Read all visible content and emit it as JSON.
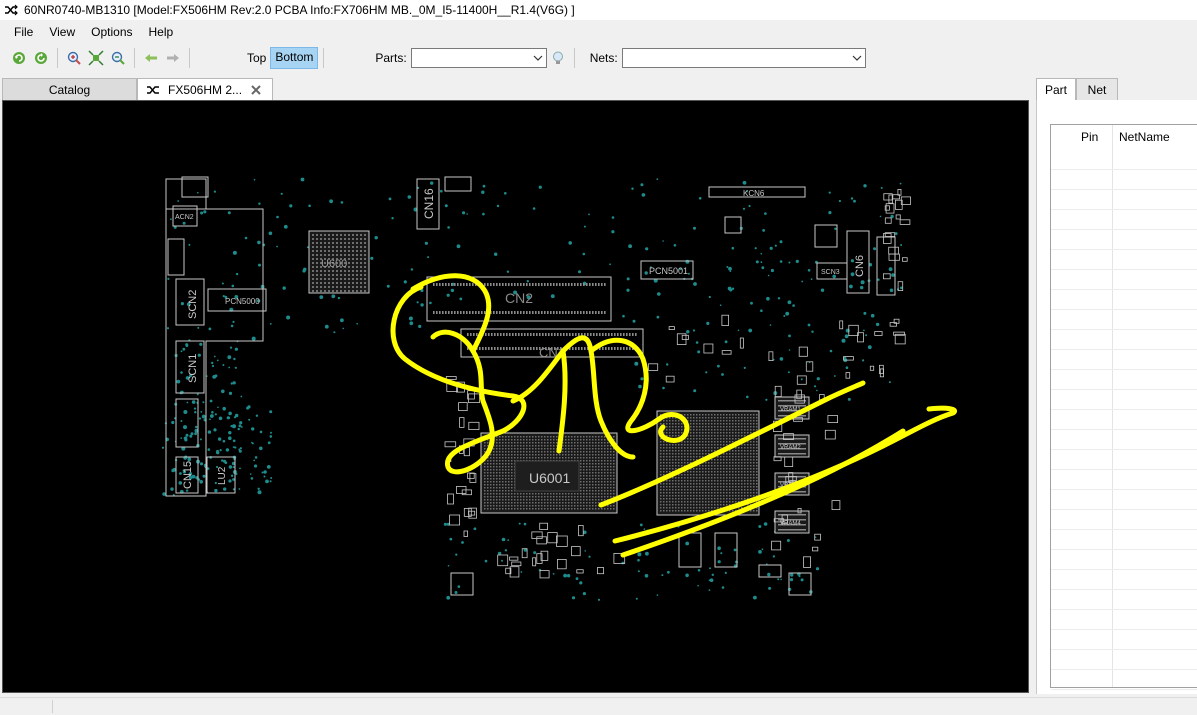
{
  "window": {
    "title": "60NR0740-MB1310 [Model:FX506HM  Rev:2.0 PCBA Info:FX706HM MB._0M_I5-11400H__R1.4(V6G) ]"
  },
  "menu": {
    "items": [
      "File",
      "View",
      "Options",
      "Help"
    ]
  },
  "toolbar": {
    "icons": [
      "refresh-icon",
      "rotate-icon",
      "zoom-in-icon",
      "fit-icon",
      "zoom-out-icon",
      "back-arrow-icon",
      "forward-arrow-icon"
    ],
    "top_label": "Top",
    "bottom_label": "Bottom",
    "active_side": "Bottom",
    "parts_label": "Parts:",
    "parts_value": "",
    "nets_label": "Nets:",
    "nets_value": ""
  },
  "tabs": [
    {
      "label": "Catalog",
      "active": false
    },
    {
      "label": "FX506HM 2...",
      "active": true,
      "icon": "shuffle-icon",
      "close_icon": "close-icon"
    }
  ],
  "board": {
    "component_labels": [
      "CN16",
      "CN2",
      "CN1",
      "U6001",
      "U600",
      "PCN5001",
      "KCN6",
      "CN6",
      "ACN2",
      "SCN2",
      "SCN1",
      "CN15",
      "LU2",
      "VRAM1",
      "VRAM2",
      "VRAM3",
      "VRAM4",
      "PCN5000",
      "SCN3"
    ],
    "annotation_color": "#ffff00",
    "silkscreen_color": "#c8c8c8",
    "via_color": "#1e8c8c"
  },
  "rightpanel": {
    "tabs": [
      {
        "label": "Part",
        "active": true
      },
      {
        "label": "Net",
        "active": false
      }
    ],
    "columns": [
      "Pin",
      "NetName"
    ]
  }
}
